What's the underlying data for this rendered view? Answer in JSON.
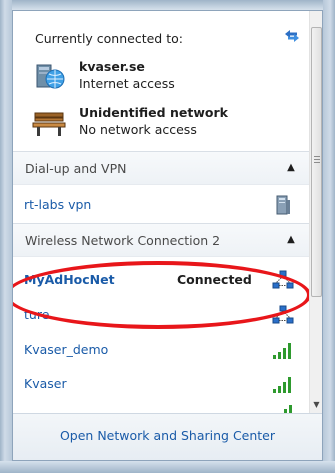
{
  "current": {
    "header": "Currently connected to:",
    "networks": [
      {
        "name": "kvaser.se",
        "status": "Internet access",
        "icon": "internet-network-icon"
      },
      {
        "name": "Unidentified network",
        "status": "No network access",
        "icon": "bench-network-icon"
      }
    ]
  },
  "dialup": {
    "title": "Dial-up and VPN",
    "items": [
      {
        "label": "rt-labs vpn",
        "icon": "vpn-server-icon"
      }
    ]
  },
  "wireless": {
    "title": "Wireless Network Connection 2",
    "items": [
      {
        "label": "MyAdHocNet",
        "state": "Connected",
        "icon": "adhoc-network-icon"
      },
      {
        "label": "ture",
        "icon": "adhoc-network-icon"
      },
      {
        "label": "Kvaser_demo",
        "icon": "wifi-signal-icon"
      },
      {
        "label": "Kvaser",
        "icon": "wifi-signal-icon"
      }
    ]
  },
  "footer": {
    "link": "Open Network and Sharing Center"
  },
  "colors": {
    "link": "#1a5ba8",
    "highlight": "#e8161a",
    "signal": "#2e9a2e"
  }
}
